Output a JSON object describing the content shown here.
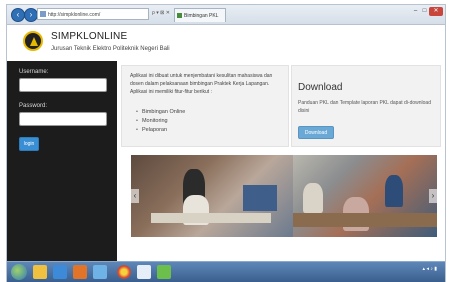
{
  "browser": {
    "address": "http://simpklonline.com/",
    "address_tools": "ρ ▾ ⊠ ✕",
    "tab_title": "Bimbingan PKL",
    "controls": {
      "minimize": "–",
      "maximize": "□",
      "close": "✕"
    }
  },
  "header": {
    "title": "SIMPKLONLINE",
    "subtitle": "Jurusan Teknik Elektro Politeknik Negeri Bali"
  },
  "login": {
    "username_label": "Username:",
    "username_value": "",
    "password_label": "Password:",
    "password_value": "",
    "button_label": "login"
  },
  "intro": {
    "text": "Aplikasi ini dibuat untuk menjembatani kesulitan mahasiswa dan dosen dalam pelaksanaan bimbingan Praktek Kerja Lapangan. Aplikasi ini memiliki fitur-fitur berikut :",
    "features": [
      "Bimbingan Online",
      "Monitoring",
      "Pelaporan"
    ]
  },
  "download": {
    "title": "Download",
    "text": "Panduan PKL dan Template laporan PKL dapat di-download disini",
    "button_label": "Download"
  },
  "icons": {
    "back": "back-icon",
    "forward": "forward-icon",
    "logo": "polytechnic-logo",
    "start": "windows-start-icon"
  },
  "colors": {
    "sidebar": "#1c1c1c",
    "login_button": "#3a8fd4",
    "download_button": "#6aa9d6",
    "taskbar": "#3a5f8e"
  }
}
